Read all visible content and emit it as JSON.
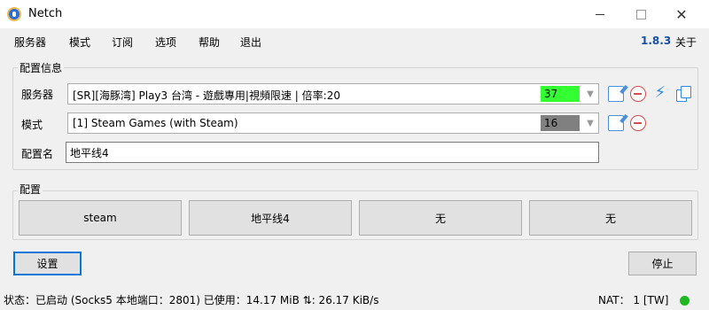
{
  "window": {
    "title": "Netch",
    "close_glyph": "✕"
  },
  "menu": {
    "items": [
      "服务器",
      "模式",
      "订阅",
      "选项",
      "帮助",
      "退出"
    ],
    "version": "1.8.3",
    "about": "关于"
  },
  "config_info": {
    "title": "配置信息",
    "server_label": "服务器",
    "server_value": "[SR][海豚湾] Play3 台湾 - 遊戲專用|視頻限速 | 倍率:20",
    "server_latency": "37",
    "server_latency_color": "#33ff33",
    "mode_label": "模式",
    "mode_value": "[1] Steam Games (with Steam)",
    "mode_latency": "16",
    "mode_latency_color": "#808080",
    "profile_name_label": "配置名",
    "profile_name_value": "地平线4",
    "icons": {
      "edit": "edit-icon",
      "delete": "minus-circle-icon",
      "speedtest": "lightning-icon",
      "copy": "copy-icon"
    }
  },
  "profiles": {
    "title": "配置",
    "buttons": [
      "steam",
      "地平线4",
      "无",
      "无"
    ]
  },
  "actions": {
    "settings": "设置",
    "stop": "停止"
  },
  "status": {
    "text": "状态：已启动 (Socks5 本地端口：2801)  已使用：14.17 MiB  ⇅: 26.17 KiB/s",
    "nat": "NAT： 1 [TW]",
    "nat_color": "#1fb81f"
  },
  "colors": {
    "accent": "#0078d7",
    "version": "#1a4fa8"
  }
}
